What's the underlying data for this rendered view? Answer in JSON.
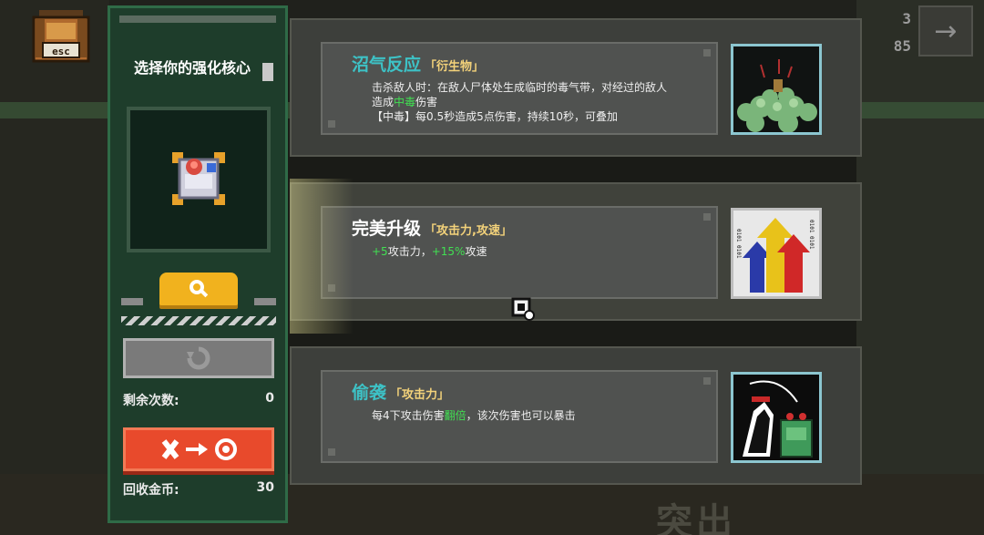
{
  "hud": {
    "top_count": "3",
    "top_value": "85",
    "arrow_icon": "→"
  },
  "panel": {
    "title": "选择你的强化核心",
    "remaining_label": "剩余次数:",
    "remaining_value": "0",
    "recycle_label": "回收金币:",
    "recycle_value": "30"
  },
  "options": [
    {
      "name": "沼气反应",
      "tag": "「衍生物」",
      "desc_lines": [
        [
          "击杀敌人时：在敌人尸体处生成临时的毒气带，对经过的敌人"
        ],
        [
          "造成",
          {
            "green": "中毒"
          },
          "伤害"
        ],
        [
          "【中毒】每0.5秒造成5点伤害，持续10秒，可叠加"
        ]
      ]
    },
    {
      "name": "完美升级",
      "tag": "「攻击力,攻速」",
      "desc_lines": [
        [
          {
            "green": "+5"
          },
          "攻击力，",
          {
            "green": "+15%"
          },
          "攻速"
        ]
      ]
    },
    {
      "name": "偷袭",
      "tag": "「攻击力」",
      "desc_lines": [
        [
          "每4下攻击伤害",
          {
            "green": "翻倍"
          },
          "，该次伤害也可以暴击"
        ]
      ]
    }
  ],
  "background": {
    "floor_text": "突出"
  },
  "colors": {
    "accent_green": "#41e052",
    "name_cyan": "#3dc2c6",
    "tag_gold": "#f3d27a",
    "recycle_red": "#e84a2c",
    "search_yellow": "#f1b21e"
  }
}
